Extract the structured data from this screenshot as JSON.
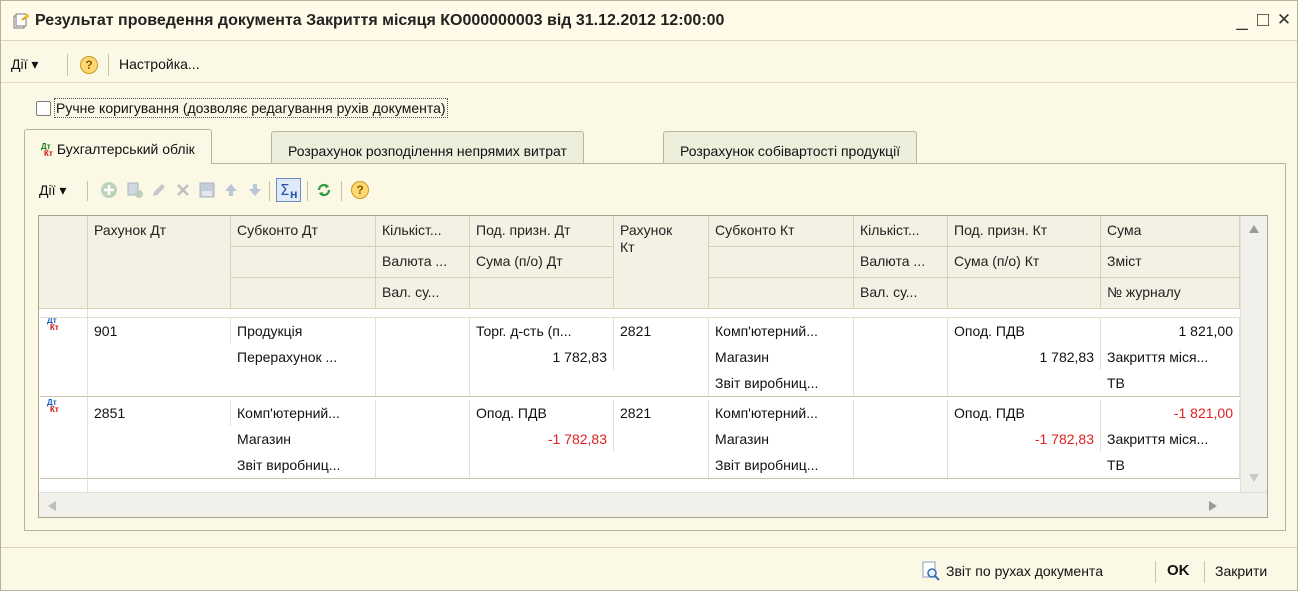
{
  "window": {
    "title": "Результат проведення документа Закриття місяця КО000000003 від 31.12.2012 12:00:00",
    "minimize": "_",
    "maximize": "□",
    "close": "✕"
  },
  "menubar": {
    "actions_label": "Дії ▾",
    "help_label": "?",
    "settings_label": "Настройка..."
  },
  "manual_checkbox": {
    "checked": false,
    "label": "Ручне коригування (дозволяє редагування рухів документа)"
  },
  "tabs": [
    {
      "label": "Бухгалтерський облік",
      "active": true,
      "icon": "dt-kt-icon"
    },
    {
      "label": "Розрахунок розподілення непрямих витрат",
      "active": false
    },
    {
      "label": "Розрахунок собівартості продукції",
      "active": false
    }
  ],
  "tab_icon": {
    "dt": "Дт",
    "kt": "Кт"
  },
  "toolbar": {
    "actions_label": "Дії ▾",
    "help_label": "?",
    "icons": [
      "add-icon",
      "copy-icon",
      "edit-icon",
      "delete-icon",
      "post-icon",
      "move-up-icon",
      "move-down-icon",
      "sum-icon",
      "refresh-icon",
      "help-icon"
    ]
  },
  "grid": {
    "headers": {
      "row1": [
        "Рахунок Дт",
        "Субконто Дт",
        "Кількіст...",
        "Под. призн. Дт",
        "Рахунок Кт",
        "Субконто Кт",
        "Кількіст...",
        "Под. призн. Кт",
        "Сума"
      ],
      "row2": [
        "Валюта ...",
        "Сума (п/о) Дт",
        "Валюта ...",
        "Сума (п/о) Кт",
        "Зміст"
      ],
      "row3": [
        "Вал. су...",
        "Вал. су...",
        "№ журналу"
      ]
    },
    "records": [
      {
        "rahunok_dt": "901",
        "subkonto_dt": [
          "Продукція",
          "Перерахунок ...",
          ""
        ],
        "kilkist_dt": "",
        "pod_dt": "Торг. д-сть (п...",
        "suma_po_dt": "1 782,83",
        "rahunok_kt": "2821",
        "subkonto_kt": [
          "Комп'ютерний...",
          "Магазин",
          "Звіт виробниц..."
        ],
        "kilkist_kt": "",
        "pod_kt": "Опод. ПДВ",
        "suma_po_kt": "1 782,83",
        "suma": "1 821,00",
        "zmist": "Закриття міся...",
        "zhurnal": "ТВ",
        "negative": false
      },
      {
        "rahunok_dt": "2851",
        "subkonto_dt": [
          "Комп'ютерний...",
          "Магазин",
          "Звіт виробниц..."
        ],
        "kilkist_dt": "",
        "pod_dt": "Опод. ПДВ",
        "suma_po_dt": "-1 782,83",
        "rahunok_kt": "2821",
        "subkonto_kt": [
          "Комп'ютерний...",
          "Магазин",
          "Звіт виробниц..."
        ],
        "kilkist_kt": "",
        "pod_kt": "Опод. ПДВ",
        "suma_po_kt": "-1 782,83",
        "suma": "-1 821,00",
        "zmist": "Закриття міся...",
        "zhurnal": "ТВ",
        "negative": true
      }
    ]
  },
  "footer": {
    "report_label": "Звіт по рухах документа",
    "ok_label": "OK",
    "close_label": "Закрити"
  },
  "colors": {
    "window_bg": "#fbf8e6",
    "negative": "#e02020",
    "accent_green": "#1a7f1a"
  }
}
